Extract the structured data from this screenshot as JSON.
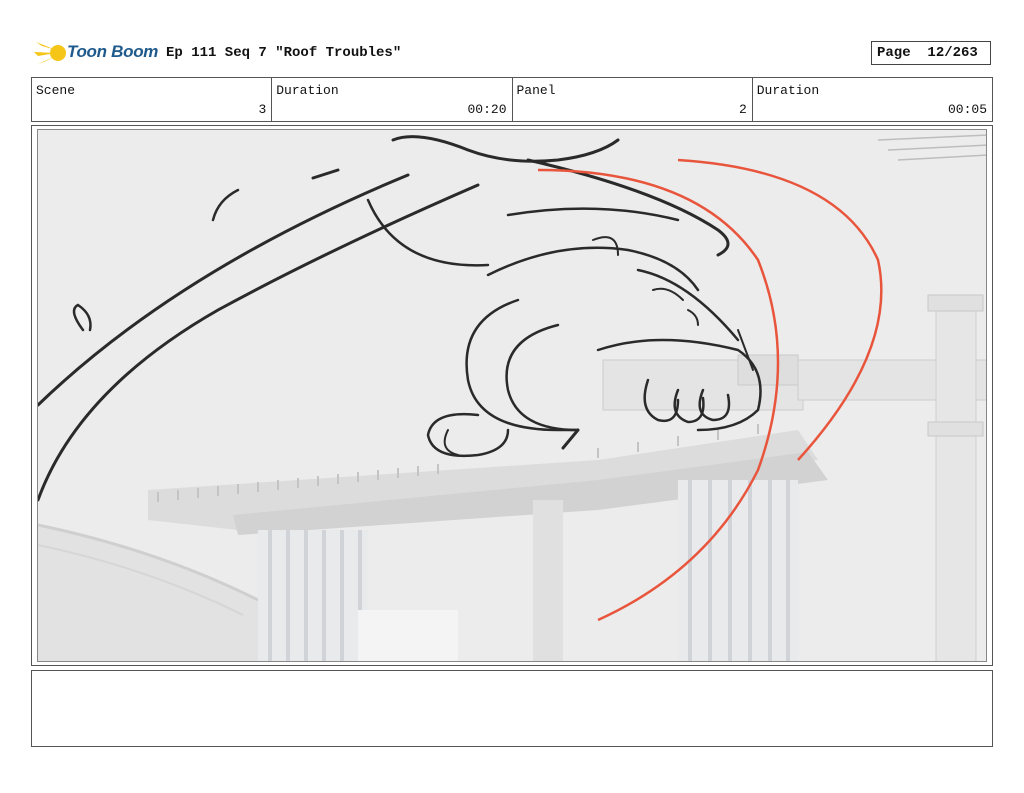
{
  "header": {
    "logo_text": "Toon Boom",
    "title": "Ep 111 Seq 7 \"Roof Troubles\"",
    "page_label": "Page",
    "page_value": "12/263"
  },
  "info": {
    "scene_label": "Scene",
    "scene_value": "3",
    "scene_duration_label": "Duration",
    "scene_duration_value": "00:20",
    "panel_label": "Panel",
    "panel_value": "2",
    "panel_duration_label": "Duration",
    "panel_duration_value": "00:05"
  },
  "notes": {
    "text": ""
  },
  "colors": {
    "logo_star": "#f5c518",
    "logo_text": "#1f5a8c",
    "sketch_line": "#2a2a2a",
    "camera_arc": "#e8553c"
  }
}
